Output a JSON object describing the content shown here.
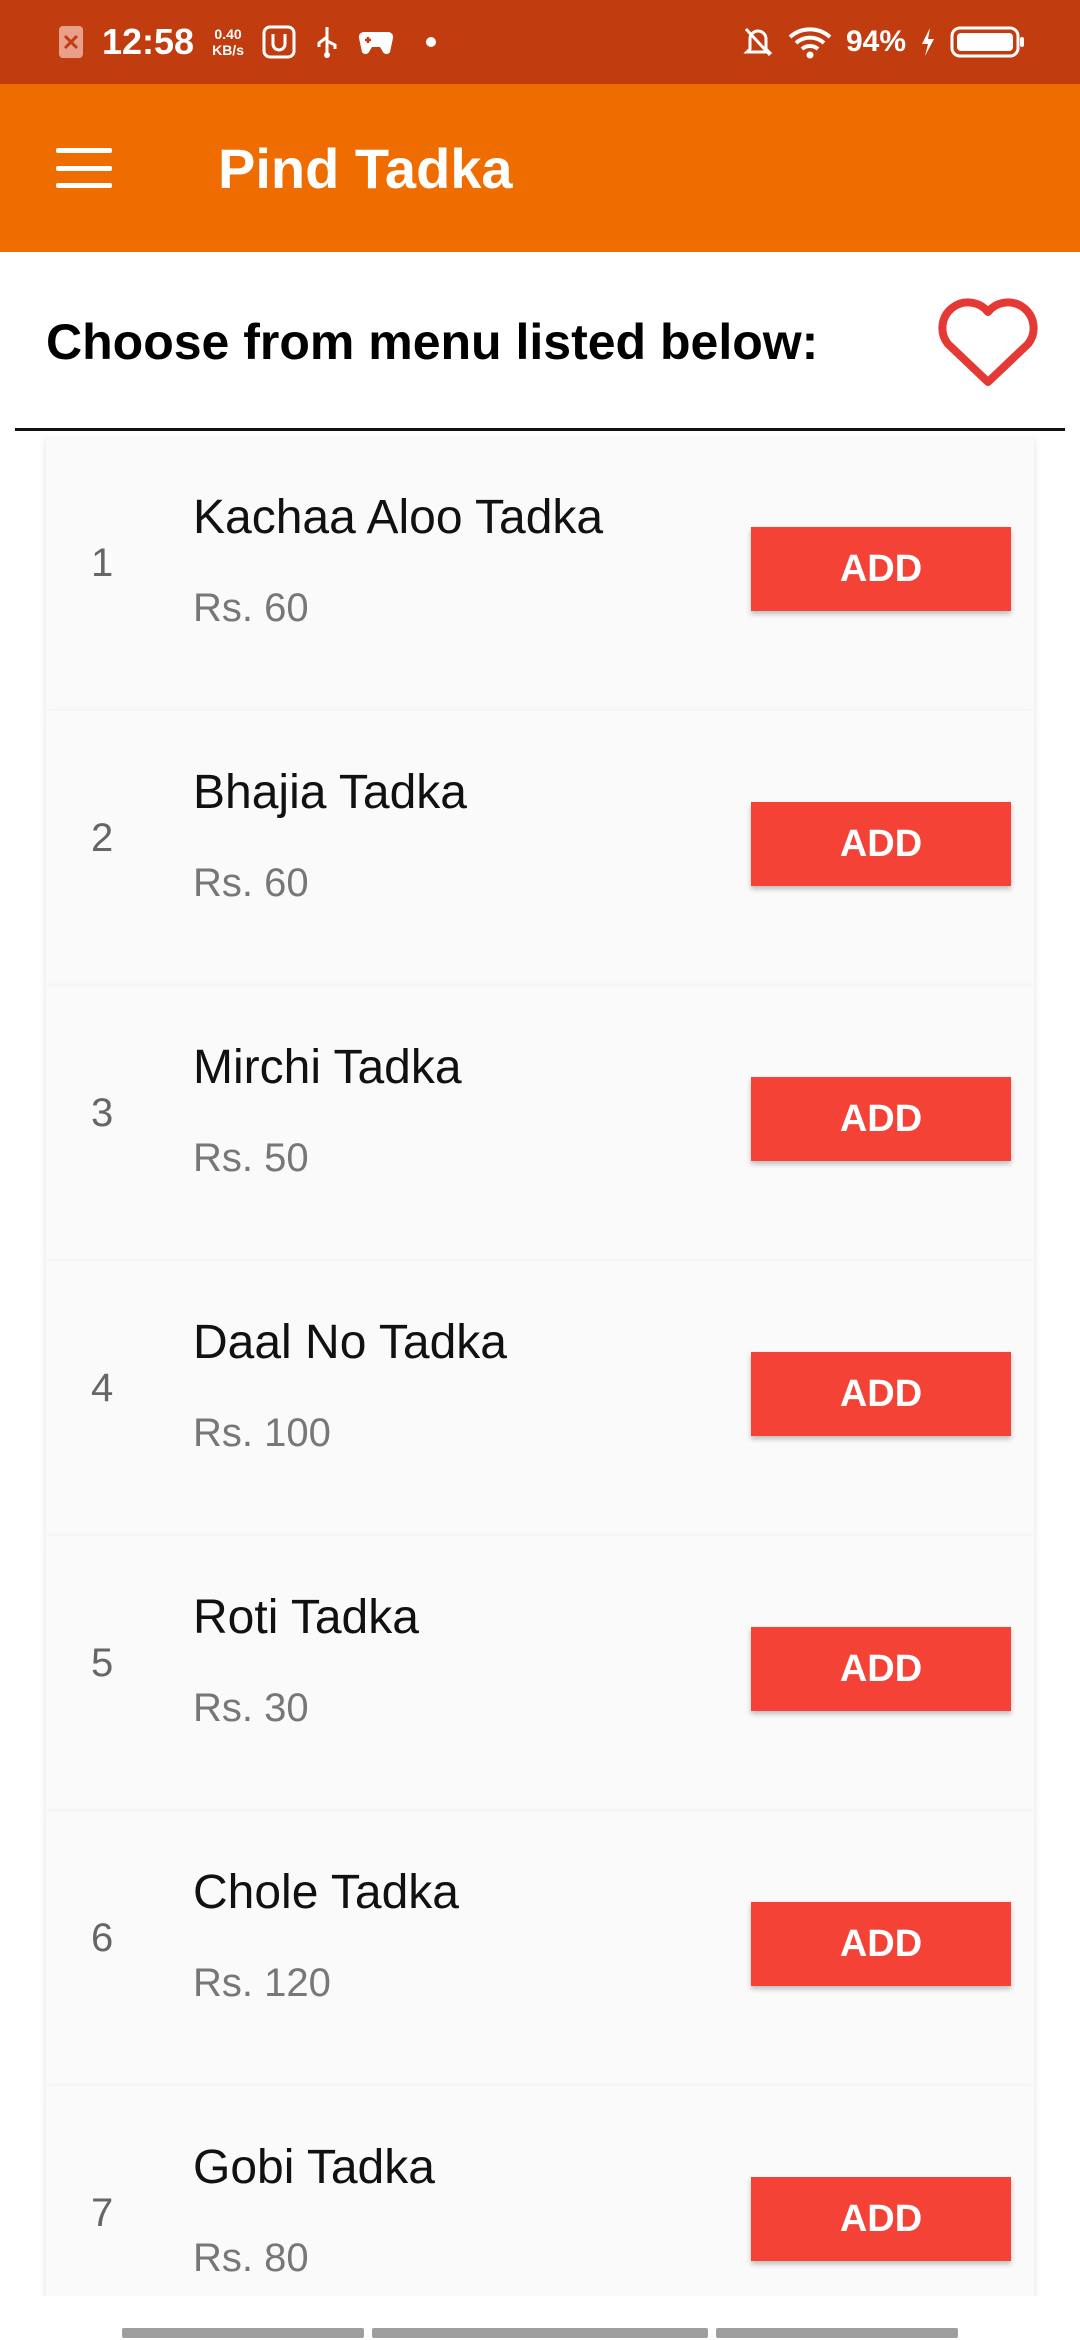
{
  "status_bar": {
    "time": "12:58",
    "speed_value": "0.40",
    "speed_unit": "KB/s",
    "battery": "94%"
  },
  "app_bar": {
    "title": "Pind Tadka",
    "menu_icon": "hamburger-menu-icon"
  },
  "header": {
    "text": "Choose from menu listed below:",
    "favorite_icon": "heart-outline-icon",
    "accent_color": "#e53935"
  },
  "colors": {
    "status_bar": "#c13d10",
    "app_bar": "#ef6c00",
    "add_button": "#f44336"
  },
  "menu": {
    "items": [
      {
        "number": "1",
        "name": "Kachaa Aloo Tadka",
        "price": "Rs. 60",
        "button": "ADD"
      },
      {
        "number": "2",
        "name": "Bhajia Tadka",
        "price": "Rs. 60",
        "button": "ADD"
      },
      {
        "number": "3",
        "name": "Mirchi Tadka",
        "price": "Rs. 50",
        "button": "ADD"
      },
      {
        "number": "4",
        "name": "Daal No Tadka",
        "price": "Rs. 100",
        "button": "ADD"
      },
      {
        "number": "5",
        "name": "Roti Tadka",
        "price": "Rs. 30",
        "button": "ADD"
      },
      {
        "number": "6",
        "name": "Chole Tadka",
        "price": "Rs. 120",
        "button": "ADD"
      },
      {
        "number": "7",
        "name": "Gobi Tadka",
        "price": "Rs. 80",
        "button": "ADD"
      }
    ]
  }
}
